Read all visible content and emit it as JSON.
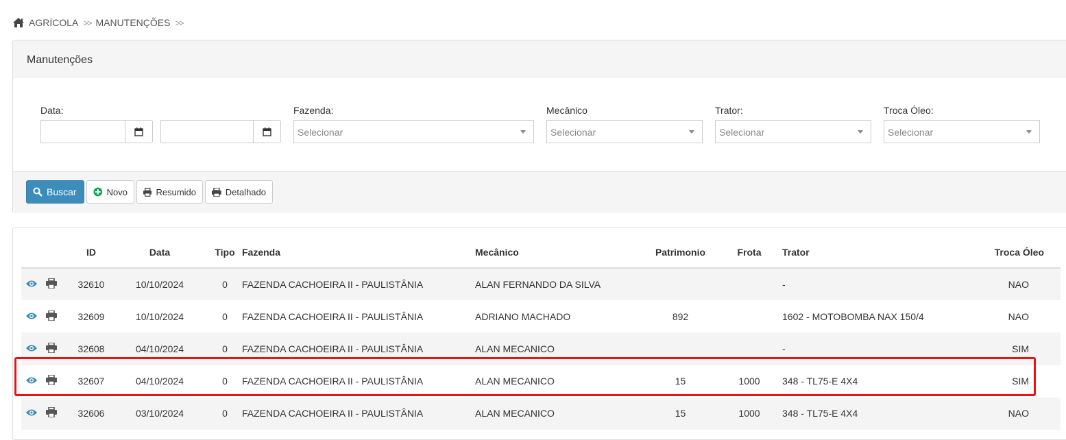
{
  "breadcrumb": {
    "home_icon": "home-icon",
    "items": [
      "AGRÍCOLA",
      "MANUTENÇÕES"
    ],
    "separator": ">>"
  },
  "panel": {
    "title": "Manutenções"
  },
  "filters": {
    "data_label": "Data:",
    "date_from": "",
    "date_to": "",
    "fazenda_label": "Fazenda:",
    "fazenda_placeholder": "Selecionar",
    "mecanico_label": "Mecânico",
    "mecanico_placeholder": "Selecionar",
    "trator_label": "Trator:",
    "trator_placeholder": "Selecionar",
    "troca_oleo_label": "Troca Óleo:",
    "troca_oleo_placeholder": "Selecionar"
  },
  "buttons": {
    "buscar": "Buscar",
    "novo": "Novo",
    "resumido": "Resumido",
    "detalhado": "Detalhado"
  },
  "colors": {
    "primary": "#3c8dbc",
    "icon_blue": "#3c8dbc",
    "add_green": "#00a65a",
    "highlight": "#ee1111"
  },
  "table": {
    "headers": [
      "ID",
      "Data",
      "Tipo",
      "Fazenda",
      "Mecânico",
      "Patrimonio",
      "Frota",
      "Trator",
      "Troca Óleo"
    ],
    "rows": [
      {
        "id": "32610",
        "data": "10/10/2024",
        "tipo": "0",
        "fazenda": "FAZENDA CACHOEIRA II - PAULISTÂNIA",
        "mecanico": "ALAN FERNANDO DA SILVA",
        "patrimonio": "",
        "frota": "",
        "trator": "-",
        "troca_oleo": "NAO"
      },
      {
        "id": "32609",
        "data": "10/10/2024",
        "tipo": "0",
        "fazenda": "FAZENDA CACHOEIRA II - PAULISTÂNIA",
        "mecanico": "ADRIANO MACHADO",
        "patrimonio": "892",
        "frota": "",
        "trator": "1602 - MOTOBOMBA NAX 150/4",
        "troca_oleo": "NAO"
      },
      {
        "id": "32608",
        "data": "04/10/2024",
        "tipo": "0",
        "fazenda": "FAZENDA CACHOEIRA II - PAULISTÂNIA",
        "mecanico": "ALAN MECANICO",
        "patrimonio": "",
        "frota": "",
        "trator": "-",
        "troca_oleo": "SIM"
      },
      {
        "id": "32607",
        "data": "04/10/2024",
        "tipo": "0",
        "fazenda": "FAZENDA CACHOEIRA II - PAULISTÂNIA",
        "mecanico": "ALAN MECANICO",
        "patrimonio": "15",
        "frota": "1000",
        "trator": "348 - TL75-E 4X4",
        "troca_oleo": "SIM"
      },
      {
        "id": "32606",
        "data": "03/10/2024",
        "tipo": "0",
        "fazenda": "FAZENDA CACHOEIRA II - PAULISTÂNIA",
        "mecanico": "ALAN MECANICO",
        "patrimonio": "15",
        "frota": "1000",
        "trator": "348 - TL75-E 4X4",
        "troca_oleo": "NAO"
      }
    ]
  }
}
